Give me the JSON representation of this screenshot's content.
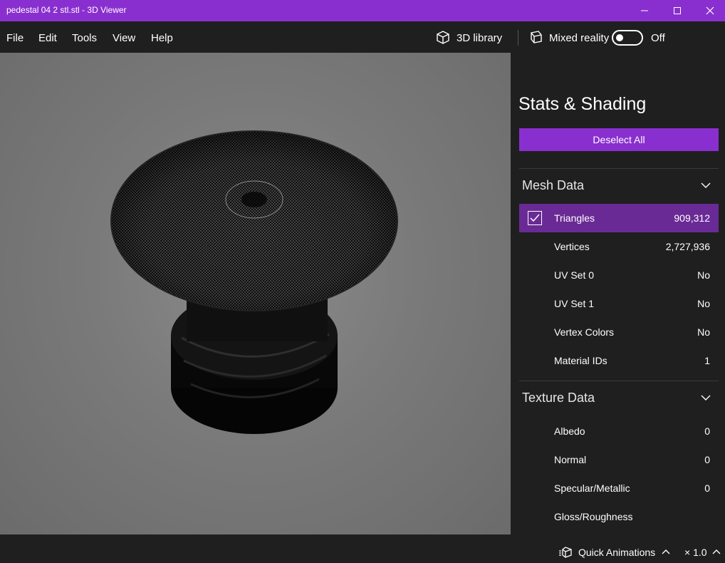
{
  "window": {
    "title": "pedestal 04 2 stl.stl - 3D Viewer"
  },
  "menu": {
    "items": [
      "File",
      "Edit",
      "Tools",
      "View",
      "Help"
    ]
  },
  "toolbar": {
    "library_label": "3D library",
    "mixed_reality_label": "Mixed reality",
    "mixed_reality_state": "Off"
  },
  "panel": {
    "title": "Stats & Shading",
    "deselect_label": "Deselect All",
    "mesh_section": {
      "title": "Mesh Data",
      "rows": [
        {
          "label": "Triangles",
          "value": "909,312"
        },
        {
          "label": "Vertices",
          "value": "2,727,936"
        },
        {
          "label": "UV Set 0",
          "value": "No"
        },
        {
          "label": "UV Set 1",
          "value": "No"
        },
        {
          "label": "Vertex Colors",
          "value": "No"
        },
        {
          "label": "Material IDs",
          "value": "1"
        }
      ]
    },
    "texture_section": {
      "title": "Texture Data",
      "rows": [
        {
          "label": "Albedo",
          "value": "0"
        },
        {
          "label": "Normal",
          "value": "0"
        },
        {
          "label": "Specular/Metallic",
          "value": "0"
        },
        {
          "label": "Gloss/Roughness",
          "value": ""
        }
      ]
    }
  },
  "statusbar": {
    "animations_label": "Quick Animations",
    "speed_label": "× 1.0"
  },
  "colors": {
    "accent": "#8a2fcf",
    "selected_row": "#6a2a95",
    "background": "#1f1f1f"
  },
  "icons": {
    "library": "cube-icon",
    "mixed_reality": "mixed-reality-icon",
    "tab_environment": "sun-icon",
    "tab_stats": "stats-icon",
    "tab_grid": "grid-icon",
    "animations": "animation-icon"
  }
}
